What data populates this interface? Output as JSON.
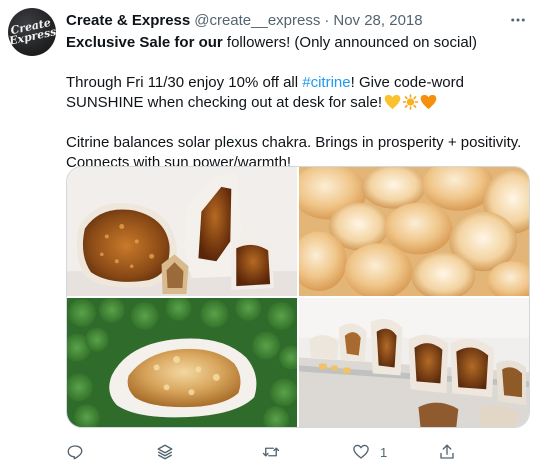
{
  "author": {
    "display_name": "Create & Express",
    "handle": "@create__express",
    "separator": "·",
    "timestamp": "Nov 28, 2018",
    "avatar_text_line1": "Create",
    "avatar_text_line2": "Express"
  },
  "tweet": {
    "line1_bold": "Exclusive Sale for our",
    "line1_rest": " followers! (Only announced on social)",
    "para2_before": "Through Fri 11/30 enjoy 10% off all ",
    "para2_hashtag": "#citrine",
    "para2_after": "! Give code-word SUNSHINE when checking out at desk for sale!",
    "para3": "Citrine balances solar plexus chakra. Brings in prosperity + positivity. Connects with sun power/warmth!",
    "emojis": [
      "yellow-heart",
      "sun",
      "orange-heart"
    ]
  },
  "media": {
    "photos": [
      "citrine-clusters-on-white",
      "tumbled-citrine-points",
      "citrine-cluster-in-clover",
      "citrine-display-shelf"
    ]
  },
  "actions": {
    "reply_count": "",
    "retweet_count": "",
    "like_count": "1",
    "share_count": ""
  },
  "colors": {
    "accent": "#1d9bf0",
    "secondary_text": "#536471",
    "border": "#cfd9de"
  }
}
